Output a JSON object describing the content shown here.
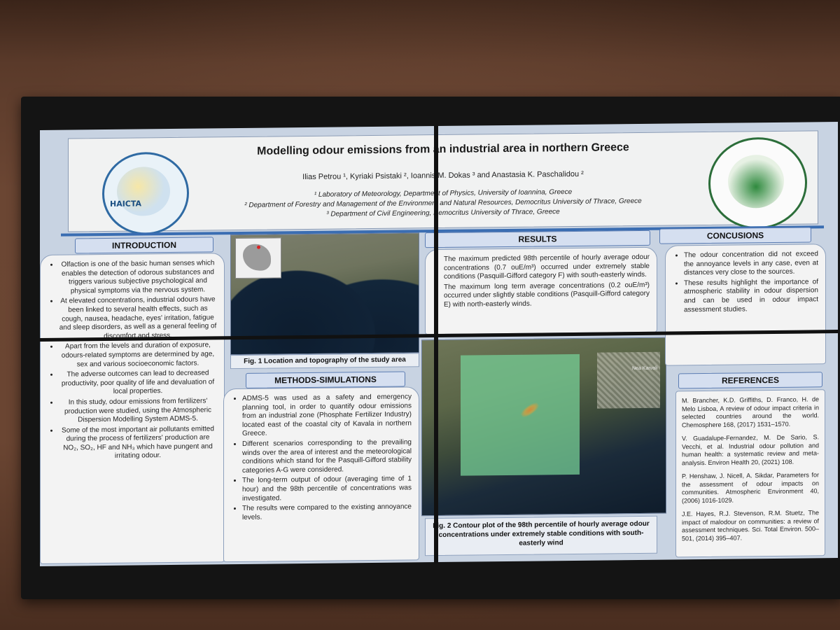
{
  "poster": {
    "title": "Modelling odour emissions from an industrial area in northern Greece",
    "authors": "Ilias Petrou ¹, Kyriaki Psistaki ², Ioannis M. Dokas ³ and Anastasia K. Paschalidou ²",
    "affiliations": [
      "¹ Laboratory of Meteorology, Department of Physics, University of Ioannina, Greece",
      "² Department of Forestry and Management of the Environment and Natural Resources, Democritus University of Thrace, Greece",
      "³ Department of Civil Engineering, Democritus University of Thrace, Greece"
    ],
    "logo_left_text": "HAICTA",
    "logo_right_label": "logo"
  },
  "introduction": {
    "heading": "INTRODUCTION",
    "items": [
      "Olfaction is one of the basic human senses which enables the detection of odorous substances and triggers various subjective psychological and physical symptoms via the nervous system.",
      "At elevated concentrations, industrial odours have been linked to several health effects, such as cough, nausea, headache, eyes' irritation, fatigue and sleep disorders, as well as a general feeling of discomfort and stress.",
      "Apart from the levels and duration of exposure, odours-related symptoms are determined by age, sex and various socioeconomic factors.",
      "The adverse outcomes can lead to decreased productivity, poor quality of life and devaluation of local properties.",
      "In this study, odour emissions from fertilizers' production were studied, using the Atmospheric Dispersion Modelling System ADMS-5.",
      "Some of the most important air pollutants emitted during the process of fertilizers' production are NO₂, SO₂, HF and NH₃ which have pungent and irritating odour."
    ]
  },
  "fig1_caption": "Fig. 1 Location and topography of the study area",
  "methods": {
    "heading": "METHODS-SIMULATIONS",
    "items": [
      "ADMS-5 was used as a safety and emergency planning tool, in order to quantify odour emissions from an industrial zone (Phosphate Fertilizer Industry) located east of the coastal city of Kavala in northern Greece.",
      "Different scenarios corresponding to the prevailing winds over the area of interest and the meteorological conditions which stand for the Pasquill-Gifford stability categories A-G were considered.",
      "The long-term output of odour (averaging time of 1 hour) and the 98th percentile of concentrations was investigated.",
      "The results were compared to the existing annoyance levels."
    ]
  },
  "results": {
    "heading": "RESULTS",
    "items": [
      "The maximum predicted 98th percentile of hourly average odour concentrations (0.7 ouE/m³) occurred under extremely stable conditions (Pasquill-Gifford category F) with south-easterly winds.",
      "The maximum long term average concentrations (0.2 ouE/m³) occurred under slightly stable conditions (Pasquill-Gifford category E) with north-easterly winds."
    ]
  },
  "fig2_caption": "Fig. 2 Contour plot of the 98th percentile of hourly average odour concentrations under extremely stable conditions with south-easterly wind",
  "map2_label": "Nea Karvali",
  "conclusions": {
    "heading": "CONCUSIONS",
    "items": [
      "The odour concentration did not exceed the annoyance levels in any case, even at distances very close to the sources.",
      "These results highlight the importance of atmospheric stability in odour dispersion and can be used in odour impact assessment studies."
    ]
  },
  "references": {
    "heading": "REFERENCES",
    "items": [
      "M. Brancher, K.D. Griffiths, D. Franco, H. de Melo Lisboa, A review of odour impact criteria in selected countries around the world. Chemosphere 168, (2017) 1531–1570.",
      "V. Guadalupe-Fernandez, M. De Sario, S. Vecchi, et al. Industrial odour pollution and human health: a systematic review and meta-analysis. Environ Health 20, (2021) 108.",
      "P. Henshaw, J. Nicell, A. Sikdar, Parameters for the assessment of odour impacts on communities. Atmospheric Environment 40, (2006) 1016-1029.",
      "J.E. Hayes, R.J. Stevenson, R.M. Stuetz, The impact of malodour on communities: a review of assessment techniques. Sci. Total Environ. 500– 501, (2014) 395–407."
    ]
  }
}
